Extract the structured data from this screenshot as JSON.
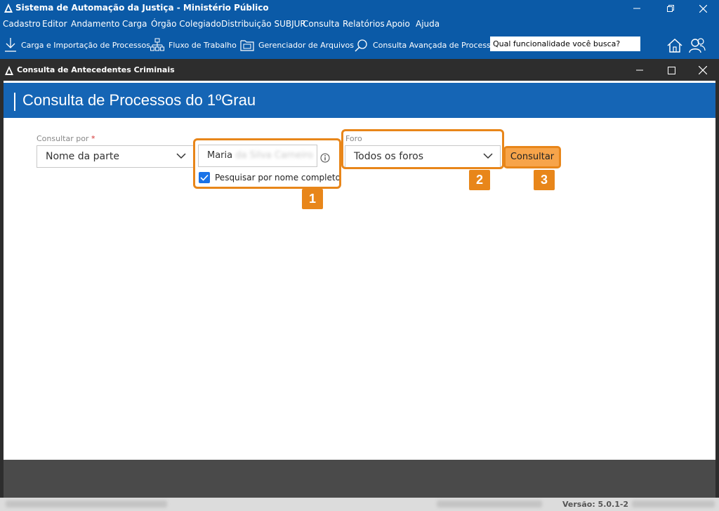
{
  "app": {
    "title": "Sistema de Automação da Justiça - Ministério Público"
  },
  "menu": [
    "Cadastro",
    "Editor",
    "Andamento",
    "Carga",
    "Órgão Colegiado",
    "Distribuição SUBJUR",
    "Consulta",
    "Relatórios",
    "Apoio",
    "Ajuda"
  ],
  "toolbar": {
    "carga": "Carga e Importação de Processos",
    "fluxo": "Fluxo de Trabalho",
    "gerenciador": "Gerenciador de Arquivos",
    "consulta_avancada": "Consulta Avançada de Processos",
    "search_value": "Qual funcionalidade você busca?"
  },
  "child_window": {
    "title": "Consulta de Antecedentes Criminais"
  },
  "page": {
    "title": "Consulta de Processos do 1ºGrau",
    "consultar_por_label": "Consultar por",
    "required_mark": "*",
    "consultar_por_value": "Nome da parte",
    "name_first": "Maria",
    "name_rest": "da Silva Carneiro",
    "checkbox_label": "Pesquisar por nome completo",
    "checkbox_checked": true,
    "foro_label": "Foro",
    "foro_value": "Todos os foros",
    "submit_label": "Consultar"
  },
  "annotations": [
    "1",
    "2",
    "3"
  ],
  "status": {
    "version": "Versão: 5.0.1-2"
  },
  "colors": {
    "titlebar": "#0b5aa7",
    "header": "#1565b5",
    "highlight": "#e8861a",
    "checkbox": "#1a73e8"
  }
}
